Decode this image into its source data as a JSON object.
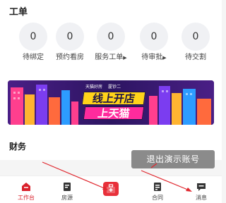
{
  "workorder": {
    "title": "工单",
    "items": [
      {
        "count": "0",
        "label": "待绑定",
        "has_arrow": false
      },
      {
        "count": "0",
        "label": "预约看房",
        "has_arrow": false
      },
      {
        "count": "0",
        "label": "服务工单",
        "has_arrow": true
      },
      {
        "count": "0",
        "label": "待审批",
        "has_arrow": true
      },
      {
        "count": "0",
        "label": "待交割",
        "has_arrow": false
      }
    ]
  },
  "banner": {
    "logo_left": "天猫好房",
    "logo_right": "厦钞二",
    "slogan_line1": "线上开店",
    "slogan_line2": "上天猫"
  },
  "finance": {
    "title": "财务"
  },
  "toast": {
    "text": "退出演示账号"
  },
  "tabbar": {
    "items": [
      {
        "label": "工作台",
        "icon": "home-icon",
        "active": true
      },
      {
        "label": "房源",
        "icon": "house-list-icon",
        "active": false
      },
      {
        "label": "",
        "icon": "toolbox-icon",
        "active": false
      },
      {
        "label": "合同",
        "icon": "contract-icon",
        "active": false
      },
      {
        "label": "消息",
        "icon": "message-icon",
        "active": false
      }
    ]
  },
  "colors": {
    "accent": "#d9212b",
    "banner_bg": "#3b1a6b",
    "slogan_yellow": "#ffd31a",
    "slogan_pink": "#ff2b9d"
  }
}
